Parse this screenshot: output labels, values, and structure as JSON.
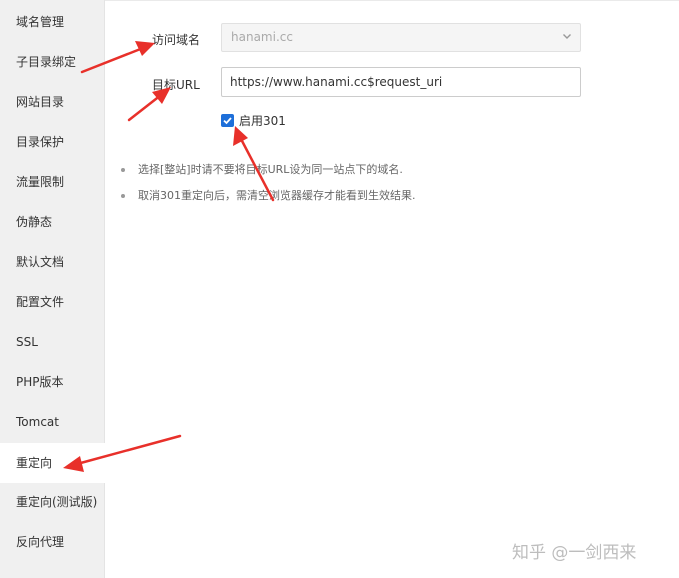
{
  "sidebar": {
    "items": [
      {
        "label": "域名管理"
      },
      {
        "label": "子目录绑定"
      },
      {
        "label": "网站目录"
      },
      {
        "label": "目录保护"
      },
      {
        "label": "流量限制"
      },
      {
        "label": "伪静态"
      },
      {
        "label": "默认文档"
      },
      {
        "label": "配置文件"
      },
      {
        "label": "SSL"
      },
      {
        "label": "PHP版本"
      },
      {
        "label": "Tomcat"
      },
      {
        "label": "重定向"
      },
      {
        "label": "重定向(测试版)"
      },
      {
        "label": "反向代理"
      }
    ],
    "active_index": 11
  },
  "form": {
    "domain_label": "访问域名",
    "domain_value": "hanami.cc",
    "target_label": "目标URL",
    "target_value": "https://www.hanami.cc$request_uri",
    "checkbox_label": "启用301",
    "checkbox_checked": true
  },
  "tips": [
    "选择[整站]时请不要将目标URL设为同一站点下的域名.",
    "取消301重定向后，需清空浏览器缓存才能看到生效结果."
  ],
  "watermark": "知乎 @一剑西来",
  "colors": {
    "annotation_arrow": "#e8302a",
    "checkbox_accent": "#1e6fd9"
  }
}
